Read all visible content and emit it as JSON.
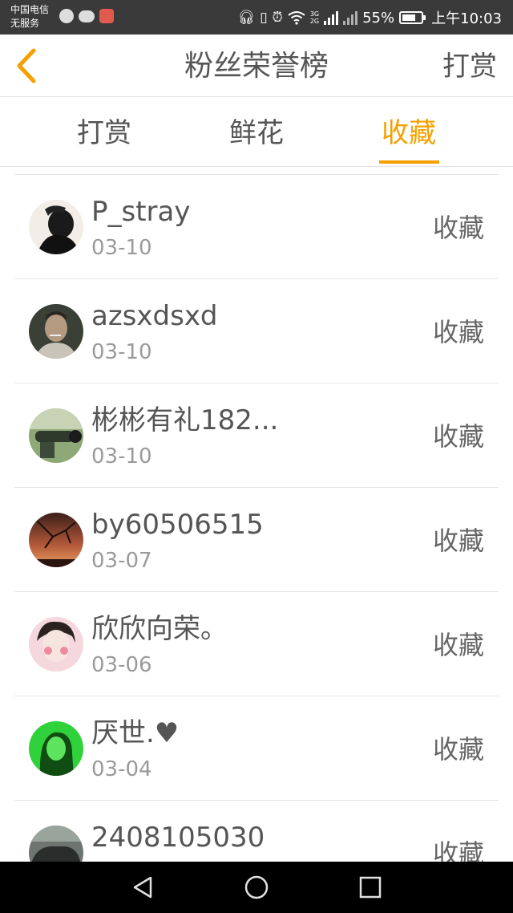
{
  "status_bar": {
    "carrier_line1": "中国电信",
    "carrier_line2": "无服务",
    "network_label_top": "3G",
    "network_label_bottom": "2G",
    "battery": "55%",
    "time": "上午10:03"
  },
  "header": {
    "title": "粉丝荣誉榜",
    "action_label": "打赏"
  },
  "tabs": [
    {
      "label": "打赏",
      "active": false
    },
    {
      "label": "鲜花",
      "active": false
    },
    {
      "label": "收藏",
      "active": true
    }
  ],
  "rows": [
    {
      "name": "P_stray",
      "date": "03-10",
      "type": "收藏"
    },
    {
      "name": "azsxdsxd",
      "date": "03-10",
      "type": "收藏"
    },
    {
      "name": "彬彬有礼182...",
      "date": "03-10",
      "type": "收藏"
    },
    {
      "name": "by60506515",
      "date": "03-07",
      "type": "收藏"
    },
    {
      "name": "欣欣向荣。",
      "date": "03-06",
      "type": "收藏"
    },
    {
      "name": "厌世.♥",
      "date": "03-04",
      "type": "收藏"
    },
    {
      "name": "2408105030",
      "date": "",
      "type": "收藏"
    }
  ],
  "colors": {
    "accent": "#f5a000",
    "status_bar": "#3a3a3a",
    "nav_bar": "#000000"
  }
}
